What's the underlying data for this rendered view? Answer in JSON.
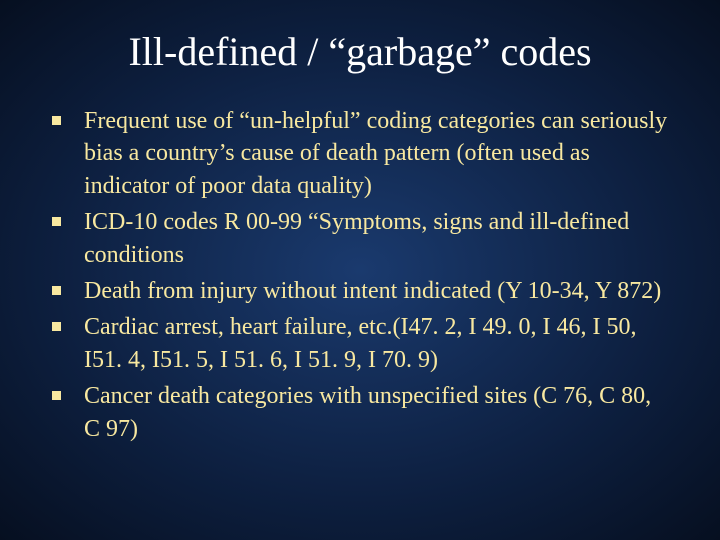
{
  "slide": {
    "title": "Ill-defined / “garbage” codes",
    "bullets": [
      "Frequent use of “un-helpful” coding categories can seriously bias a country’s cause of death pattern (often used as indicator of poor data quality)",
      "ICD-10 codes R 00-99 “Symptoms, signs and ill-defined conditions",
      "Death from injury without intent indicated (Y 10-34, Y 872)",
      "Cardiac arrest, heart failure, etc.(I47. 2, I 49. 0, I 46, I 50, I51. 4, I51. 5, I 51. 6, I 51. 9, I 70. 9)",
      "Cancer death categories with unspecified sites (C 76, C 80, C 97)"
    ]
  }
}
